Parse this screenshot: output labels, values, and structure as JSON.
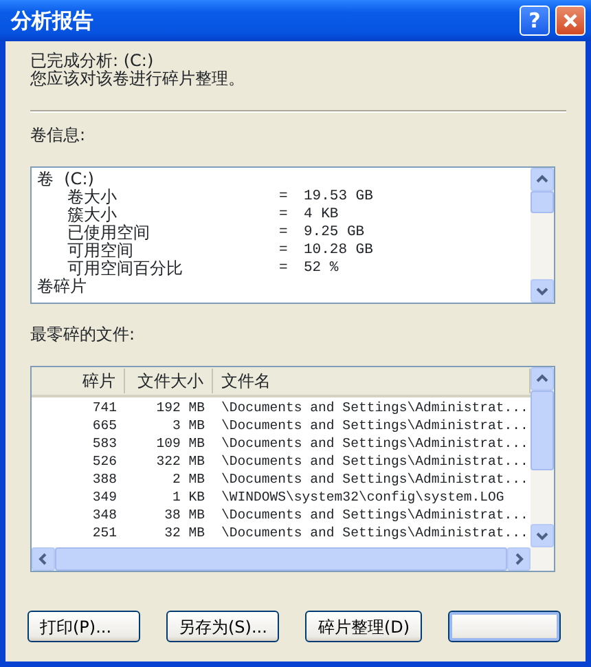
{
  "window": {
    "title": "分析报告",
    "help_button": "?"
  },
  "summary": [
    "已完成分析: (C:)",
    "您应该对该卷进行碎片整理。"
  ],
  "volume_info": {
    "label": "卷信息:",
    "rows": [
      {
        "kind": "heading",
        "name": "卷  (C:)"
      },
      {
        "kind": "item",
        "name": "卷大小",
        "separator": "=",
        "value": "19.53 GB"
      },
      {
        "kind": "item",
        "name": "簇大小",
        "separator": "=",
        "value": "4 KB"
      },
      {
        "kind": "item",
        "name": "已使用空间",
        "separator": "=",
        "value": "9.25 GB"
      },
      {
        "kind": "item",
        "name": "可用空间",
        "separator": "=",
        "value": "10.28 GB"
      },
      {
        "kind": "item",
        "name": "可用空间百分比",
        "separator": "=",
        "value": "52 %"
      },
      {
        "kind": "heading",
        "name": "卷碎片"
      }
    ]
  },
  "files": {
    "label": "最零碎的文件:",
    "columns": [
      "碎片",
      "文件大小",
      "文件名"
    ],
    "rows": [
      [
        "741",
        "192 MB",
        "\\Documents and Settings\\Administrat..."
      ],
      [
        "665",
        "3 MB",
        "\\Documents and Settings\\Administrat..."
      ],
      [
        "583",
        "109 MB",
        "\\Documents and Settings\\Administrat..."
      ],
      [
        "526",
        "322 MB",
        "\\Documents and Settings\\Administrat..."
      ],
      [
        "388",
        "2 MB",
        "\\Documents and Settings\\Administrat..."
      ],
      [
        "349",
        "1 KB",
        "\\WINDOWS\\system32\\config\\system.LOG"
      ],
      [
        "348",
        "38 MB",
        "\\Documents and Settings\\Administrat..."
      ],
      [
        "251",
        "32 MB",
        "\\Documents and Settings\\Administrat..."
      ]
    ]
  },
  "buttons": [
    {
      "label": "打印(P)...",
      "default": false
    },
    {
      "label": "另存为(S)...",
      "default": false
    },
    {
      "label": "碎片整理(D)",
      "default": false
    },
    {
      "default": true
    }
  ]
}
